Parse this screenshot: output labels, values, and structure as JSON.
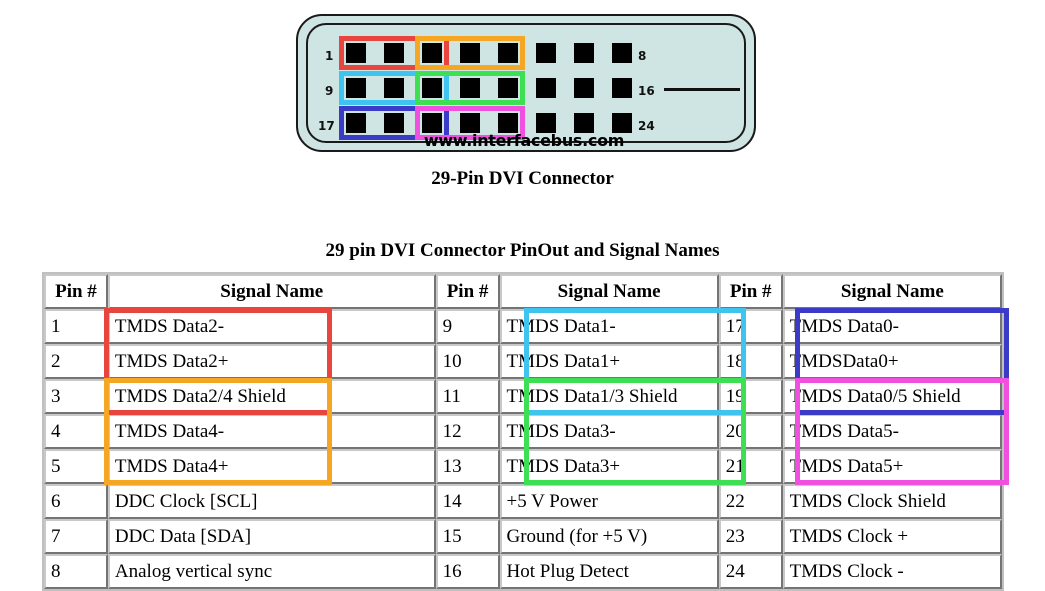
{
  "diagram": {
    "caption": "29-Pin DVI Connector",
    "watermark": "www.interfacebus.com",
    "row_labels_left": [
      "1",
      "9",
      "17"
    ],
    "row_labels_right": [
      "8",
      "16",
      "24"
    ],
    "shell_color": "#cfe5e4",
    "pin_color": "#000000",
    "groups": [
      {
        "name": "tmds-data2-group",
        "color": "#e8453f",
        "row": 0,
        "from_pin": 1,
        "to_pin": 3
      },
      {
        "name": "tmds-data4-group",
        "color": "#f5a623",
        "row": 0,
        "from_pin": 3,
        "to_pin": 5
      },
      {
        "name": "tmds-data1-group",
        "color": "#3fc4ef",
        "row": 1,
        "from_pin": 9,
        "to_pin": 11
      },
      {
        "name": "tmds-data3-group",
        "color": "#3ce052",
        "row": 1,
        "from_pin": 11,
        "to_pin": 13
      },
      {
        "name": "tmds-data0-group",
        "color": "#3b3bc8",
        "row": 2,
        "from_pin": 17,
        "to_pin": 19
      },
      {
        "name": "tmds-data5-group",
        "color": "#f050e0",
        "row": 2,
        "from_pin": 19,
        "to_pin": 21
      }
    ]
  },
  "table": {
    "title": "29 pin DVI Connector PinOut and Signal Names",
    "headers": [
      "Pin #",
      "Signal Name",
      "Pin #",
      "Signal Name",
      "Pin #",
      "Signal Name"
    ],
    "rows": [
      {
        "p1": "1",
        "s1": "TMDS Data2-",
        "p2": "9",
        "s2": "TMDS Data1-",
        "p3": "17",
        "s3": "TMDS Data0-"
      },
      {
        "p1": "2",
        "s1": "TMDS Data2+",
        "p2": "10",
        "s2": "TMDS Data1+",
        "p3": "18",
        "s3": "TMDSData0+"
      },
      {
        "p1": "3",
        "s1": "TMDS Data2/4 Shield",
        "p2": "11",
        "s2": "TMDS Data1/3 Shield",
        "p3": "19",
        "s3": "TMDS Data0/5 Shield"
      },
      {
        "p1": "4",
        "s1": "TMDS Data4-",
        "p2": "12",
        "s2": "TMDS Data3-",
        "p3": "20",
        "s3": "TMDS Data5-"
      },
      {
        "p1": "5",
        "s1": "TMDS Data4+",
        "p2": "13",
        "s2": "TMDS Data3+",
        "p3": "21",
        "s3": "TMDS Data5+"
      },
      {
        "p1": "6",
        "s1": "DDC Clock [SCL]",
        "p2": "14",
        "s2": "+5 V Power",
        "p3": "22",
        "s3": "TMDS Clock Shield"
      },
      {
        "p1": "7",
        "s1": "DDC Data [SDA]",
        "p2": "15",
        "s2": "Ground (for +5 V)",
        "p3": "23",
        "s3": "TMDS Clock +"
      },
      {
        "p1": "8",
        "s1": "Analog vertical sync",
        "p2": "16",
        "s2": "Hot Plug Detect",
        "p3": "24",
        "s3": "TMDS Clock -"
      }
    ],
    "highlights": [
      {
        "name": "highlight-tmds-data2",
        "color": "#e8453f",
        "col": 1,
        "from_row": 0,
        "to_row": 2
      },
      {
        "name": "highlight-tmds-data4",
        "color": "#f5a623",
        "col": 1,
        "from_row": 2,
        "to_row": 4
      },
      {
        "name": "highlight-tmds-data1",
        "color": "#3fc4ef",
        "col": 2,
        "from_row": 0,
        "to_row": 2
      },
      {
        "name": "highlight-tmds-data3",
        "color": "#3ce052",
        "col": 2,
        "from_row": 2,
        "to_row": 4
      },
      {
        "name": "highlight-tmds-data0",
        "color": "#3b3bc8",
        "col": 3,
        "from_row": 0,
        "to_row": 2
      },
      {
        "name": "highlight-tmds-data5",
        "color": "#f050e0",
        "col": 3,
        "from_row": 2,
        "to_row": 4
      }
    ]
  }
}
